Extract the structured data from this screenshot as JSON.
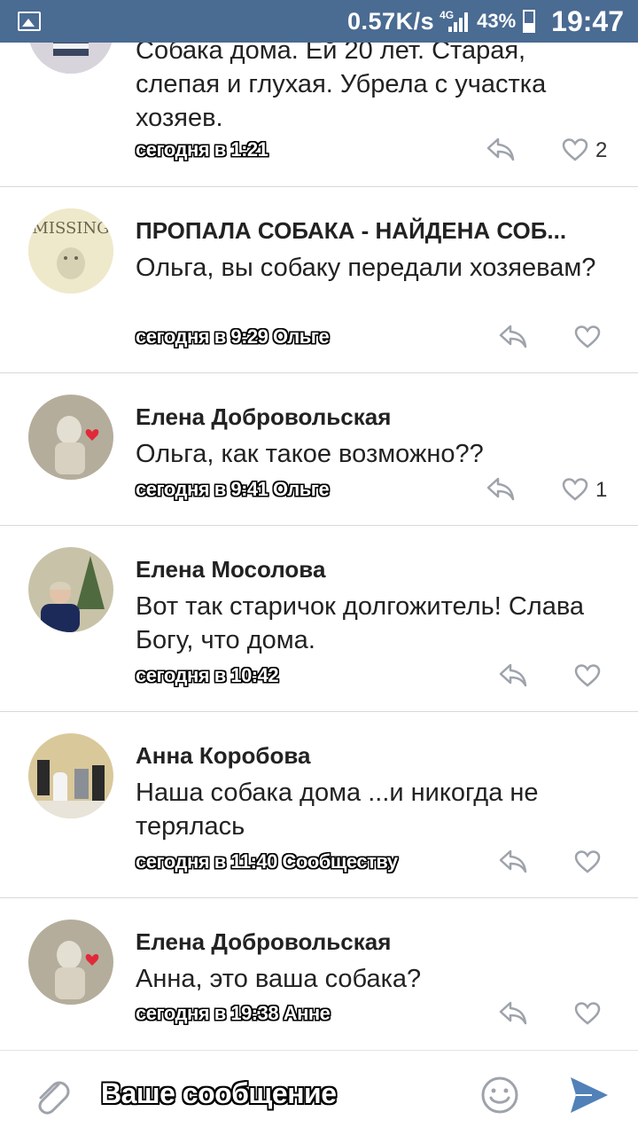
{
  "status_bar": {
    "speed": "0.57K/s",
    "network": "4G",
    "battery": "43%",
    "time": "19:47"
  },
  "comments": [
    {
      "author": "",
      "text": "Собака дома. Ей 20 лет. Старая, слепая и глухая. Убрела с участка хозяев.",
      "meta": "сегодня в 1:21",
      "likes": "2"
    },
    {
      "author": "ПРОПАЛА СОБАКА - НАЙДЕНА СОБ...",
      "text": "Ольга, вы собаку передали хозяевам?",
      "meta": "сегодня в 9:29 Ольге",
      "likes": "",
      "avatar_text": "MISSING"
    },
    {
      "author": "Елена Добровольская",
      "text": "Ольга, как такое возможно??",
      "meta": "сегодня в 9:41 Ольге",
      "likes": "1"
    },
    {
      "author": "Елена Мосолова",
      "text": "Вот так старичок долгожитель! Слава Богу, что дома.",
      "meta": "сегодня в 10:42",
      "likes": ""
    },
    {
      "author": "Анна Коробова",
      "text": "Наша собака дома ...и никогда не терялась",
      "meta": "сегодня в 11:40 Сообществу",
      "likes": ""
    },
    {
      "author": "Елена Добровольская",
      "text": "Анна, это ваша собака?",
      "meta": "сегодня в 19:38 Анне",
      "likes": ""
    }
  ],
  "input": {
    "placeholder": "Ваше сообщение"
  },
  "colors": {
    "status_bar": "#4a6b92",
    "icon_gray": "#9ea3ab",
    "send_blue": "#5181b8"
  }
}
